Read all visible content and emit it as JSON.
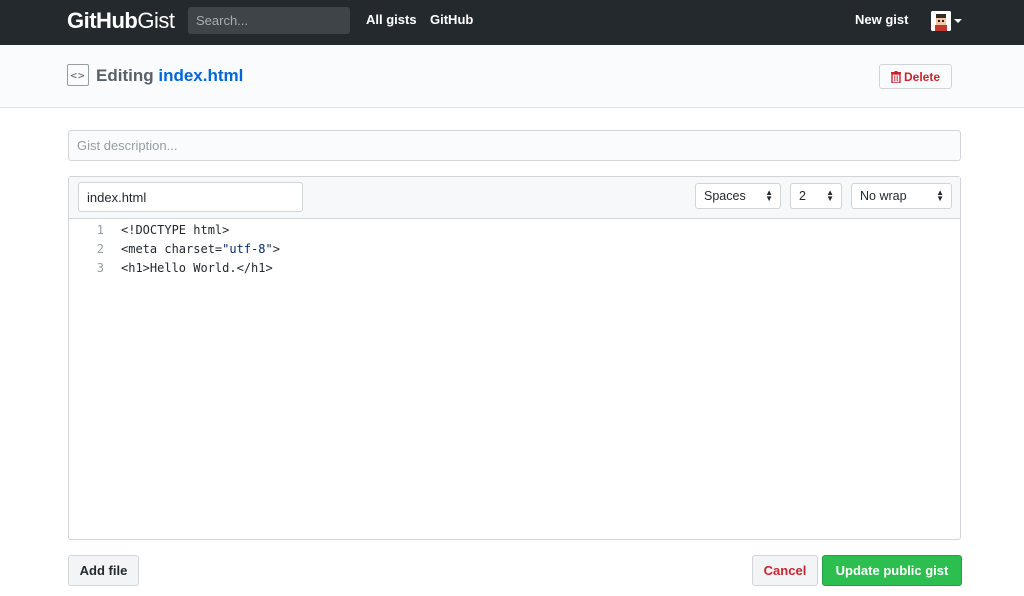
{
  "header": {
    "logo_bold": "GitHub",
    "logo_light": "Gist",
    "search_placeholder": "Search...",
    "nav": [
      "All gists",
      "GitHub"
    ],
    "new_gist": "New gist"
  },
  "pagehead": {
    "editing_label": "Editing",
    "filename": "index.html",
    "delete_label": "Delete"
  },
  "form": {
    "description_placeholder": "Gist description..."
  },
  "editor": {
    "filename_value": "index.html",
    "indent_mode": "Spaces",
    "indent_size": "2",
    "wrap_mode": "No wrap",
    "lines": [
      {
        "num": "1",
        "text": "<!DOCTYPE html>"
      },
      {
        "num": "2",
        "pre": "<meta charset=",
        "str": "\"utf-8\"",
        "post": ">"
      },
      {
        "num": "3",
        "text": "<h1>Hello World.</h1>"
      }
    ]
  },
  "footer": {
    "add_file": "Add file",
    "cancel": "Cancel",
    "update": "Update public gist"
  }
}
